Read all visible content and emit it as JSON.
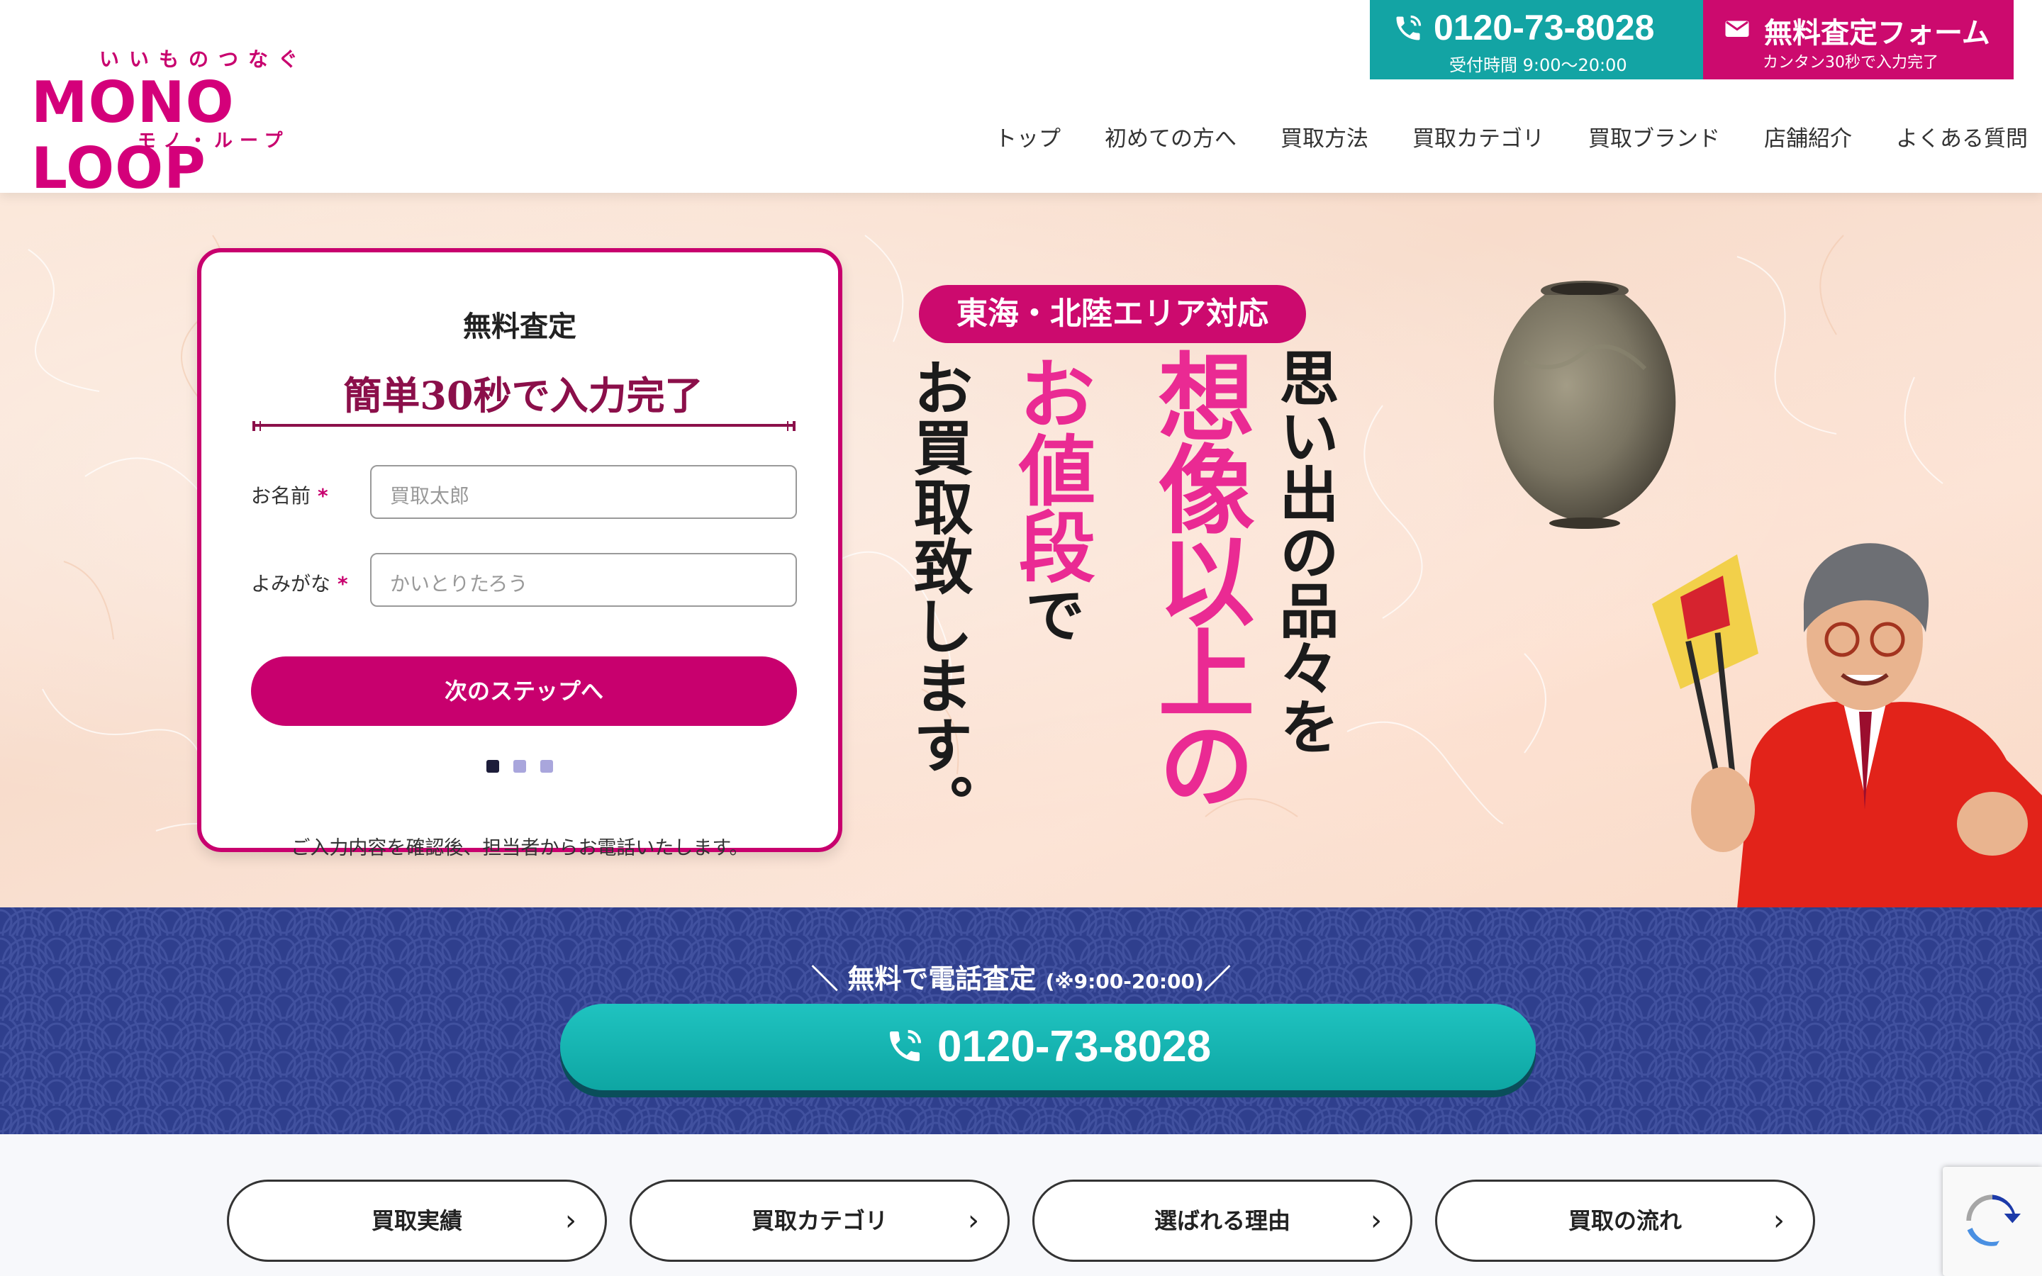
{
  "header": {
    "logo": {
      "tagline": "いいものつなぐ",
      "wordmark": "MONO LOOP",
      "kana": "モノ・ループ"
    },
    "phone": {
      "number": "0120-73-8028",
      "hours": "受付時間 9:00〜20:00"
    },
    "form": {
      "label": "無料査定フォーム",
      "sub": "カンタン30秒で入力完了"
    },
    "nav": [
      "トップ",
      "初めての方へ",
      "買取方法",
      "買取カテゴリ",
      "買取ブランド",
      "店舗紹介",
      "よくある質問"
    ]
  },
  "hero": {
    "card": {
      "title": "無料査定",
      "heading": "簡単30秒で入力完了",
      "fields": [
        {
          "label": "お名前",
          "required": "*",
          "placeholder": "買取太郎"
        },
        {
          "label": "よみがな",
          "required": "*",
          "placeholder": "かいとりたろう"
        }
      ],
      "next_button": "次のステップへ",
      "note": "ご入力内容を確認後、担当者からお電話いたします。"
    },
    "badge": "東海・北陸エリア対応",
    "copy": {
      "line1": "思い出の品々を",
      "line2": "想像以上の",
      "line3_big": "お値段",
      "line3_small": "で",
      "line4": "お買取致します。"
    }
  },
  "band": {
    "caption": "＼ 無料で電話査定",
    "caption_hours": "(※9:00-20:00)",
    "caption_end": "／",
    "phone": "0120-73-8028"
  },
  "links": [
    "買取実績",
    "買取カテゴリ",
    "選ばれる理由",
    "買取の流れ"
  ],
  "colors": {
    "brand_pink": "#c8006e",
    "teal": "#13a4a4",
    "navy": "#2f3f8d"
  }
}
